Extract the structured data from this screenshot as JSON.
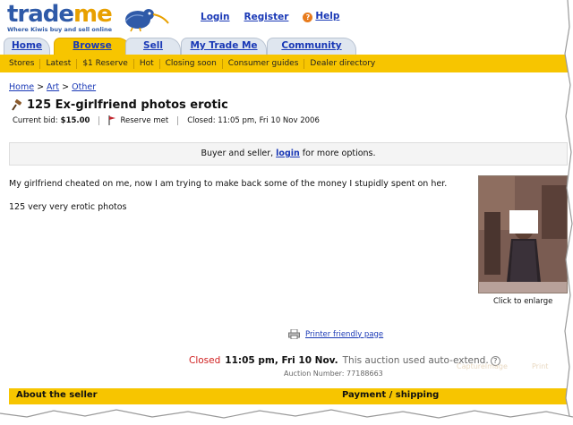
{
  "header": {
    "logo_trade": "trade",
    "logo_me": "me",
    "tagline": "Where Kiwis buy and sell online",
    "links": {
      "login": "Login",
      "register": "Register",
      "help": "Help"
    }
  },
  "tabs": [
    {
      "label": "Home",
      "active": false
    },
    {
      "label": "Browse",
      "active": true
    },
    {
      "label": "Sell",
      "active": false
    },
    {
      "label": "My Trade Me",
      "active": false
    },
    {
      "label": "Community",
      "active": false
    }
  ],
  "subnav": [
    "Stores",
    "Latest",
    "$1 Reserve",
    "Hot",
    "Closing soon",
    "Consumer guides",
    "Dealer directory"
  ],
  "breadcrumb": [
    "Home",
    "Art",
    "Other"
  ],
  "listing": {
    "title": "125 Ex-girlfriend photos erotic",
    "current_bid_label": "Current bid:",
    "current_bid": "$15.00",
    "reserve": "Reserve met",
    "closed": "Closed: 11:05 pm, Fri 10 Nov 2006"
  },
  "login_bar": {
    "before": "Buyer and seller,",
    "link": "login",
    "after": "for more options."
  },
  "description": [
    "My girlfriend cheated on me, now I am trying to make back some of the money I stupidly spent on her.",
    "125 very very erotic photos"
  ],
  "photo": {
    "enlarge": "Click to enlarge"
  },
  "printer_link": "Printer friendly page",
  "closing": {
    "status": "Closed",
    "time": "11:05 pm, Fri 10 Nov.",
    "note": "This auction used auto-extend.",
    "help": "?",
    "auction_number": "Auction Number: 77188663"
  },
  "watermark": {
    "capture": "CaptureImage",
    "print": "Print"
  },
  "footer": {
    "about_seller": "About the seller",
    "payment": "Payment / shipping"
  },
  "colors": {
    "brand_blue": "#2f5aa8",
    "brand_orange": "#e8a000",
    "nav_yellow": "#f7c500",
    "link_blue": "#1a39b6",
    "closed_red": "#d02020"
  }
}
